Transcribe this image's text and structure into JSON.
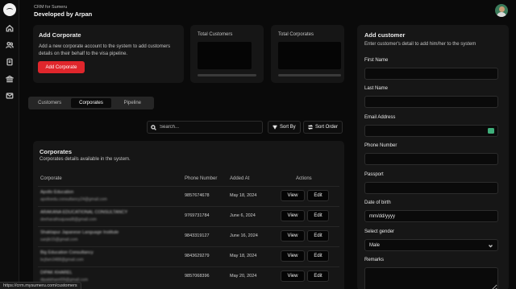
{
  "header": {
    "subtitle": "CRM for Sumeru",
    "title": "Developed by Arpan"
  },
  "nav": {
    "icons": [
      "home-icon",
      "users-icon",
      "document-icon",
      "bank-icon",
      "mail-icon"
    ]
  },
  "add_corporate": {
    "title": "Add Corporate",
    "description": "Add a new corporate account to the system to add customers details on their behalf to the visa pipeline.",
    "button_label": "Add Corporate",
    "accent": "#e0262c"
  },
  "stats": {
    "customers_label": "Total Customers",
    "corporates_label": "Total Corporates"
  },
  "tabs": {
    "items": [
      "Customers",
      "Corporates",
      "Pipeline"
    ],
    "active": "Corporates"
  },
  "toolbar": {
    "search_placeholder": "Search...",
    "sort_by_label": "Sort By",
    "sort_order_label": "Sort Order"
  },
  "corporates": {
    "title": "Corporates",
    "subtitle": "Corporates details available in the system.",
    "columns": [
      "Corporate",
      "Phone Number",
      "Added At",
      "Actions"
    ],
    "view_label": "View",
    "edit_label": "Edit",
    "rows": [
      {
        "name": "Apollo Education",
        "email": "apolloedu.consultancy24@gmail.com",
        "phone": "9857674678",
        "added": "May 18, 2024"
      },
      {
        "name": "ARAKANA EDUCATIONAL CONSULTANCY",
        "email": "deeharathsajuwal8@gmail.com",
        "phone": "9769731784",
        "added": "June 6, 2024"
      },
      {
        "name": "Shaktapur Japanese Language Institute",
        "email": "sanjib15@gmail.com",
        "phone": "9843319127",
        "added": "June 16, 2024"
      },
      {
        "name": "Big Education Consultancy",
        "email": "bcjfam3488@gmail.com",
        "phone": "9843629279",
        "added": "May 18, 2024"
      },
      {
        "name": "DIPAK KHAREL",
        "email": "dipakkharel09@gmail.com",
        "phone": "9857068396",
        "added": "May 20, 2024"
      }
    ]
  },
  "add_customer": {
    "title": "Add customer",
    "subtitle": "Enter customer's detail to add him/her to the system",
    "fields": {
      "first_name": "First Name",
      "last_name": "Last Name",
      "email": "Email Address",
      "phone": "Phone Number",
      "passport": "Passport",
      "dob": "Date of birth",
      "dob_placeholder": "mm/dd/yyyy",
      "gender": "Select gender",
      "gender_value": "Male",
      "remarks": "Remarks"
    }
  },
  "status_url": "https://crm.mysumeru.com/customers"
}
